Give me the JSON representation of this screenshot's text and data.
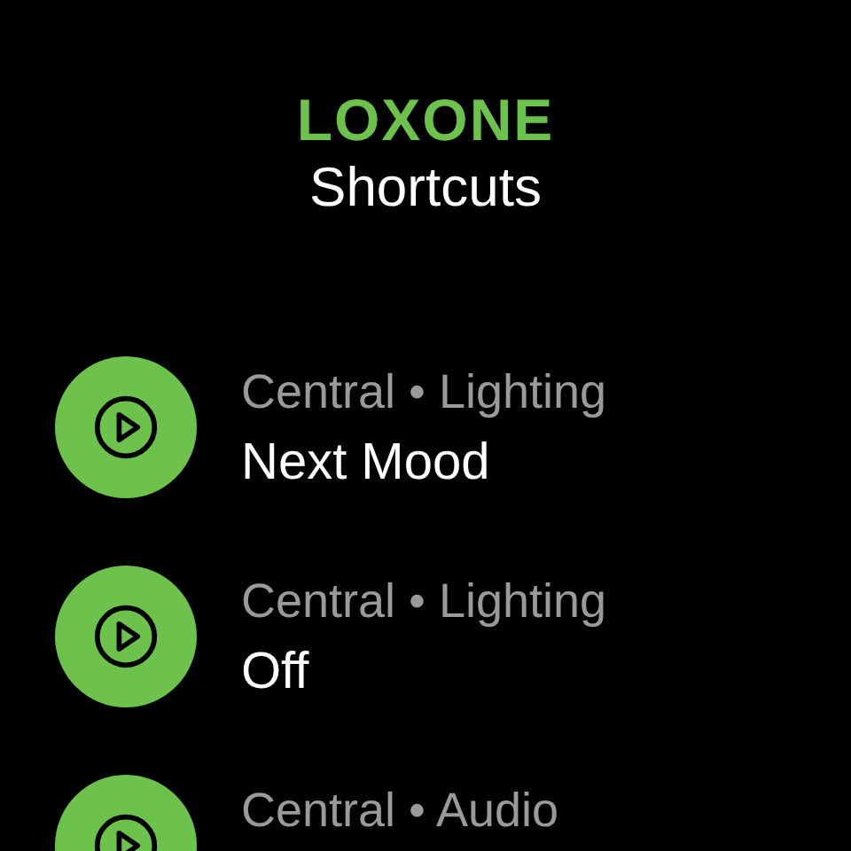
{
  "header": {
    "logo": "LOXONE",
    "title": "Shortcuts"
  },
  "shortcuts": [
    {
      "subtitle": "Central • Lighting",
      "title": "Next Mood"
    },
    {
      "subtitle": "Central • Lighting",
      "title": "Off"
    },
    {
      "subtitle": "Central • Audio"
    }
  ]
}
